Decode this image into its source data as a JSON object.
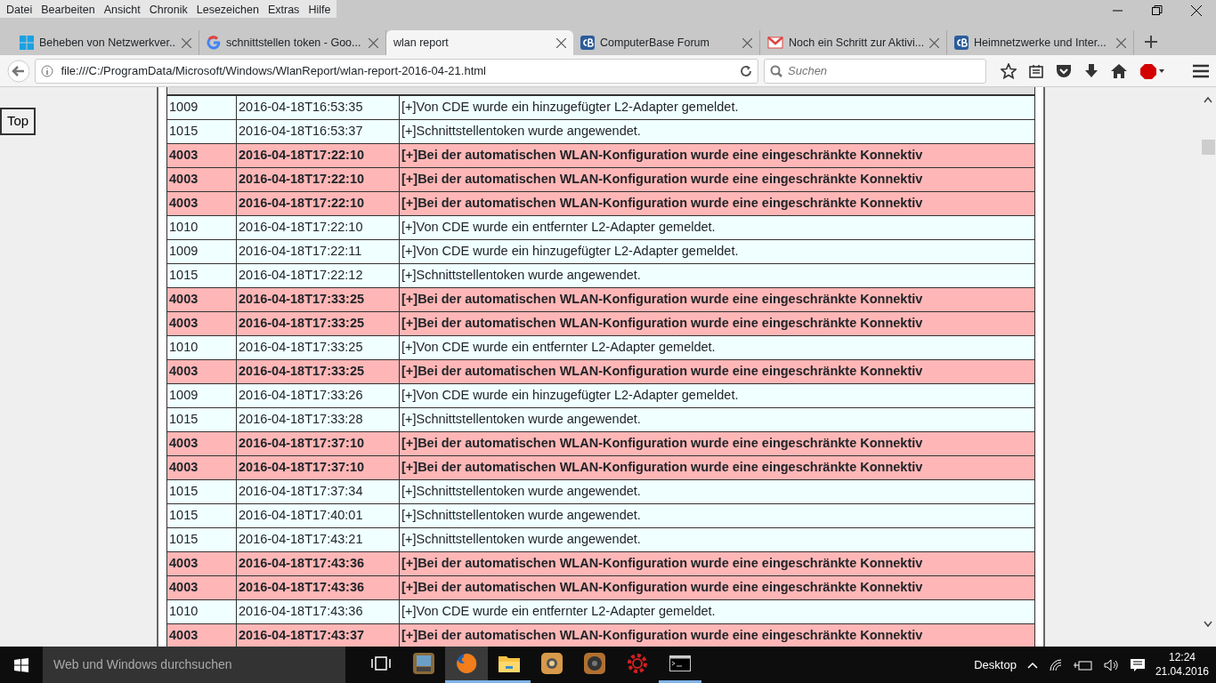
{
  "menu": [
    "Datei",
    "Bearbeiten",
    "Ansicht",
    "Chronik",
    "Lesezeichen",
    "Extras",
    "Hilfe"
  ],
  "tabs": [
    {
      "label": "Beheben von Netzwerkver...",
      "kind": "windows",
      "selected": false
    },
    {
      "label": "schnittstellen token - Goo...",
      "kind": "google",
      "selected": false
    },
    {
      "label": "wlan report",
      "kind": "plain",
      "selected": true
    },
    {
      "label": "ComputerBase Forum",
      "kind": "forum",
      "selected": false
    },
    {
      "label": "Noch ein Schritt zur Aktivi...",
      "kind": "mail",
      "selected": false
    },
    {
      "label": "Heimnetzwerke und Inter...",
      "kind": "forum",
      "selected": false
    }
  ],
  "address": "file:///C:/ProgramData/Microsoft/Windows/WlanReport/wlan-report-2016-04-21.html",
  "search": {
    "placeholder": "Suchen"
  },
  "top_button": "Top",
  "rows": [
    {
      "kind": "info",
      "id": "1009",
      "time": "2016-04-18T16:53:35",
      "message": "[+]Von CDE wurde ein hinzugefügter L2-Adapter gemeldet."
    },
    {
      "kind": "info",
      "id": "1015",
      "time": "2016-04-18T16:53:37",
      "message": "[+]Schnittstellentoken wurde angewendet."
    },
    {
      "kind": "error",
      "id": "4003",
      "time": "2016-04-18T17:22:10",
      "message": "[+]Bei der automatischen WLAN-Konfiguration wurde eine eingeschränkte Konnektiv"
    },
    {
      "kind": "error",
      "id": "4003",
      "time": "2016-04-18T17:22:10",
      "message": "[+]Bei der automatischen WLAN-Konfiguration wurde eine eingeschränkte Konnektiv"
    },
    {
      "kind": "error",
      "id": "4003",
      "time": "2016-04-18T17:22:10",
      "message": "[+]Bei der automatischen WLAN-Konfiguration wurde eine eingeschränkte Konnektiv"
    },
    {
      "kind": "info",
      "id": "1010",
      "time": "2016-04-18T17:22:10",
      "message": "[+]Von CDE wurde ein entfernter L2-Adapter gemeldet."
    },
    {
      "kind": "info",
      "id": "1009",
      "time": "2016-04-18T17:22:11",
      "message": "[+]Von CDE wurde ein hinzugefügter L2-Adapter gemeldet."
    },
    {
      "kind": "info",
      "id": "1015",
      "time": "2016-04-18T17:22:12",
      "message": "[+]Schnittstellentoken wurde angewendet."
    },
    {
      "kind": "error",
      "id": "4003",
      "time": "2016-04-18T17:33:25",
      "message": "[+]Bei der automatischen WLAN-Konfiguration wurde eine eingeschränkte Konnektiv"
    },
    {
      "kind": "error",
      "id": "4003",
      "time": "2016-04-18T17:33:25",
      "message": "[+]Bei der automatischen WLAN-Konfiguration wurde eine eingeschränkte Konnektiv"
    },
    {
      "kind": "info",
      "id": "1010",
      "time": "2016-04-18T17:33:25",
      "message": "[+]Von CDE wurde ein entfernter L2-Adapter gemeldet."
    },
    {
      "kind": "error",
      "id": "4003",
      "time": "2016-04-18T17:33:25",
      "message": "[+]Bei der automatischen WLAN-Konfiguration wurde eine eingeschränkte Konnektiv"
    },
    {
      "kind": "info",
      "id": "1009",
      "time": "2016-04-18T17:33:26",
      "message": "[+]Von CDE wurde ein hinzugefügter L2-Adapter gemeldet."
    },
    {
      "kind": "info",
      "id": "1015",
      "time": "2016-04-18T17:33:28",
      "message": "[+]Schnittstellentoken wurde angewendet."
    },
    {
      "kind": "error",
      "id": "4003",
      "time": "2016-04-18T17:37:10",
      "message": "[+]Bei der automatischen WLAN-Konfiguration wurde eine eingeschränkte Konnektiv"
    },
    {
      "kind": "error",
      "id": "4003",
      "time": "2016-04-18T17:37:10",
      "message": "[+]Bei der automatischen WLAN-Konfiguration wurde eine eingeschränkte Konnektiv"
    },
    {
      "kind": "info",
      "id": "1015",
      "time": "2016-04-18T17:37:34",
      "message": "[+]Schnittstellentoken wurde angewendet."
    },
    {
      "kind": "info",
      "id": "1015",
      "time": "2016-04-18T17:40:01",
      "message": "[+]Schnittstellentoken wurde angewendet."
    },
    {
      "kind": "info",
      "id": "1015",
      "time": "2016-04-18T17:43:21",
      "message": "[+]Schnittstellentoken wurde angewendet."
    },
    {
      "kind": "error",
      "id": "4003",
      "time": "2016-04-18T17:43:36",
      "message": "[+]Bei der automatischen WLAN-Konfiguration wurde eine eingeschränkte Konnektiv"
    },
    {
      "kind": "error",
      "id": "4003",
      "time": "2016-04-18T17:43:36",
      "message": "[+]Bei der automatischen WLAN-Konfiguration wurde eine eingeschränkte Konnektiv"
    },
    {
      "kind": "info",
      "id": "1010",
      "time": "2016-04-18T17:43:36",
      "message": "[+]Von CDE wurde ein entfernter L2-Adapter gemeldet."
    },
    {
      "kind": "error",
      "id": "4003",
      "time": "2016-04-18T17:43:37",
      "message": "[+]Bei der automatischen WLAN-Konfiguration wurde eine eingeschränkte Konnektiv"
    }
  ],
  "taskbar": {
    "search_placeholder": "Web und Windows durchsuchen",
    "apps": [
      {
        "kind": "taskview",
        "selected": false,
        "running": false
      },
      {
        "kind": "doc",
        "selected": false,
        "running": false
      },
      {
        "kind": "firefox",
        "selected": true,
        "running": true
      },
      {
        "kind": "folder",
        "selected": false,
        "running": true
      },
      {
        "kind": "camera",
        "selected": false,
        "running": false
      },
      {
        "kind": "speaker",
        "selected": false,
        "running": false
      },
      {
        "kind": "gear",
        "selected": false,
        "running": false
      },
      {
        "kind": "console",
        "selected": false,
        "running": true
      }
    ],
    "desktop": "Desktop",
    "time": "12:24",
    "date": "21.04.2016"
  }
}
